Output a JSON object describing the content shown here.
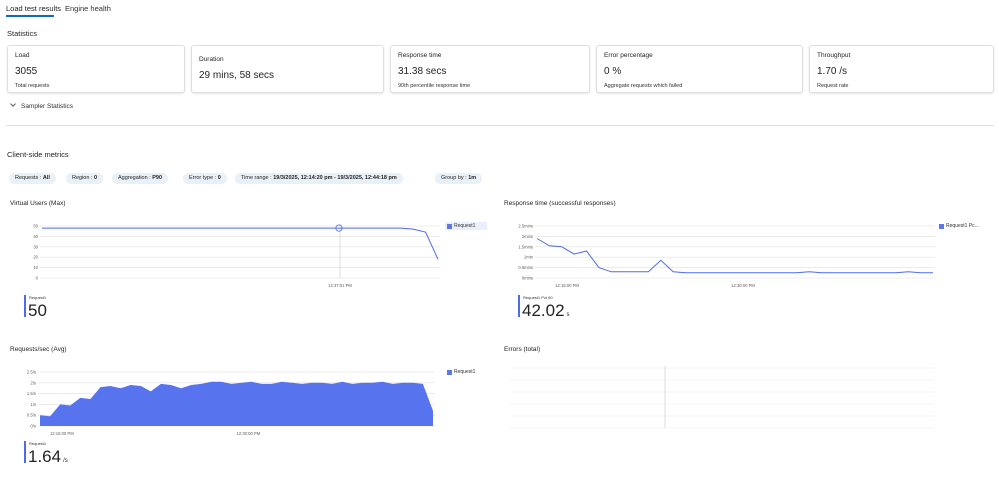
{
  "tabs": [
    "Load test results",
    "Engine health"
  ],
  "statistics": {
    "title": "Statistics",
    "cards": [
      {
        "title": "Load",
        "value": "3055",
        "sub": "Total requests"
      },
      {
        "title": "Duration",
        "value": "29 mins, 58 secs",
        "sub": ""
      },
      {
        "title": "Response time",
        "value": "31.38 secs",
        "sub": "90th percentile response time"
      },
      {
        "title": "Error percentage",
        "value": "0 %",
        "sub": "Aggregate requests which failed"
      },
      {
        "title": "Throughput",
        "value": "1.70 /s",
        "sub": "Request rate"
      }
    ],
    "sampler_label": "Sampler Statistics"
  },
  "metrics": {
    "title": "Client-side metrics",
    "filters": [
      {
        "label": "Requests : ",
        "value": "All"
      },
      {
        "label": "Region : ",
        "value": "0"
      },
      {
        "label": "Aggregation : ",
        "value": "P90"
      },
      {
        "label": "Error type : ",
        "value": "0"
      },
      {
        "label": "Time range : ",
        "value": "19/3/2025, 12:14:20 pm - 19/3/2025, 12:44:18 pm"
      },
      {
        "label": "Group by : ",
        "value": "1m"
      }
    ]
  },
  "colors": {
    "series": "#4f6bed",
    "accent": "#0f6cbd"
  },
  "chart_data": [
    {
      "type": "line",
      "title": "Virtual Users (Max)",
      "y_ticks": [
        "50",
        "40",
        "30",
        "20",
        "10",
        "0"
      ],
      "ylim": [
        0,
        50
      ],
      "x_tick_labels": [
        "12:37:01 PM"
      ],
      "x_ticks_at": [
        0.75
      ],
      "cursor_at": 0.75,
      "series": [
        {
          "name": "Request1",
          "values": [
            48,
            48,
            48,
            48,
            48,
            48,
            48,
            48,
            48,
            48,
            48,
            48,
            48,
            48,
            48,
            48,
            48,
            48,
            48,
            48,
            48,
            48,
            48,
            48,
            48,
            48,
            48,
            48,
            48,
            48,
            47,
            44,
            18
          ]
        }
      ],
      "kpi": {
        "label": "Request1",
        "value": "50",
        "unit": ""
      }
    },
    {
      "type": "line",
      "title": "Response time (successful responses)",
      "y_ticks": [
        "2.5mins",
        "2mins",
        "1.5mins",
        "1min",
        "0.5mins",
        "0mins"
      ],
      "ylim": [
        0,
        2.5
      ],
      "x_tick_labels": [
        "12:15:00 PM",
        "12:30:00 PM"
      ],
      "x_ticks_at": [
        0.08,
        0.52
      ],
      "series": [
        {
          "name": "Request1 Pc...",
          "values": [
            1.9,
            1.55,
            1.5,
            1.15,
            1.3,
            0.5,
            0.3,
            0.3,
            0.3,
            0.3,
            0.85,
            0.3,
            0.25,
            0.25,
            0.25,
            0.25,
            0.25,
            0.25,
            0.25,
            0.25,
            0.25,
            0.25,
            0.3,
            0.25,
            0.25,
            0.25,
            0.25,
            0.25,
            0.25,
            0.25,
            0.3,
            0.25,
            0.25
          ]
        }
      ],
      "kpi": {
        "label": "Request1 Pct 90",
        "value": "42.02",
        "unit": "s"
      }
    },
    {
      "type": "area",
      "title": "Requests/sec (Avg)",
      "y_ticks": [
        "2.5/s",
        "2/s",
        "1.5/s",
        "1/s",
        "0.5/s",
        "0/s"
      ],
      "ylim": [
        0,
        2.5
      ],
      "x_tick_labels": [
        "12:15:00 PM",
        "12:30:00 PM"
      ],
      "x_ticks_at": [
        0.06,
        0.53
      ],
      "series": [
        {
          "name": "Request1",
          "values": [
            0.5,
            0.45,
            1.0,
            0.95,
            1.3,
            1.25,
            1.8,
            1.85,
            1.75,
            1.9,
            1.85,
            1.6,
            1.95,
            1.9,
            1.75,
            1.9,
            1.95,
            2.05,
            2.05,
            1.95,
            2.0,
            2.05,
            1.95,
            1.95,
            2.05,
            2.0,
            1.95,
            2.0,
            2.0,
            1.95,
            2.05,
            1.95,
            2.0,
            2.0,
            2.05,
            1.95,
            2.0,
            2.0,
            1.95,
            0.7
          ]
        }
      ],
      "kpi": {
        "label": "Request1",
        "value": "1.64",
        "unit": "/s"
      }
    },
    {
      "type": "line",
      "title": "Errors (total)",
      "y_ticks": [],
      "x_tick_labels": [],
      "series": [],
      "kpi": null
    }
  ]
}
